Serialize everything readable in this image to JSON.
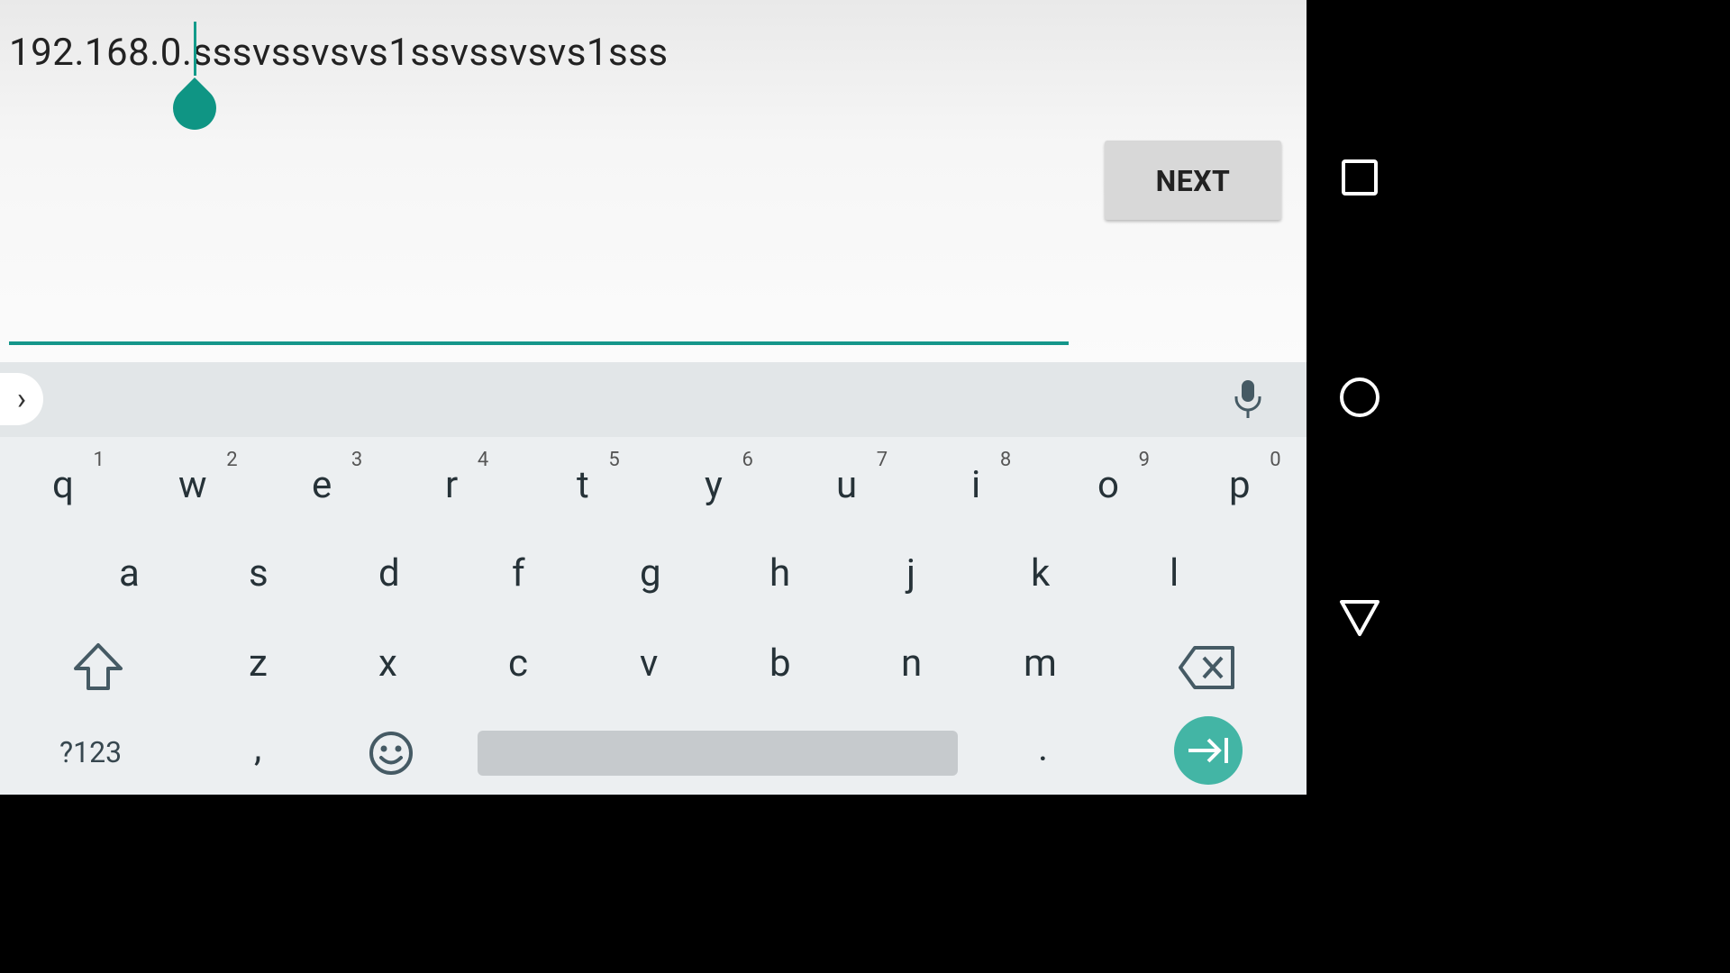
{
  "editor": {
    "text": "192.168.0.sssvssvsvs1ssvssvsvs1sss",
    "next_label": "NEXT"
  },
  "keyboard": {
    "row1": [
      {
        "key": "q",
        "num": "1"
      },
      {
        "key": "w",
        "num": "2"
      },
      {
        "key": "e",
        "num": "3"
      },
      {
        "key": "r",
        "num": "4"
      },
      {
        "key": "t",
        "num": "5"
      },
      {
        "key": "y",
        "num": "6"
      },
      {
        "key": "u",
        "num": "7"
      },
      {
        "key": "i",
        "num": "8"
      },
      {
        "key": "o",
        "num": "9"
      },
      {
        "key": "p",
        "num": "0"
      }
    ],
    "row2": [
      "a",
      "s",
      "d",
      "f",
      "g",
      "h",
      "j",
      "k",
      "l"
    ],
    "row3": [
      "z",
      "x",
      "c",
      "v",
      "b",
      "n",
      "m"
    ],
    "symbols_label": "?123",
    "comma": ",",
    "period": ".",
    "icons": {
      "expand": "chevron-right-icon",
      "mic": "microphone-icon",
      "shift": "shift-icon",
      "backspace": "backspace-icon",
      "emoji": "emoji-icon",
      "enter": "next-field-icon"
    },
    "accent_color": "#43b5a5"
  },
  "nav": {
    "icons": [
      "square-icon",
      "circle-icon",
      "triangle-back-icon"
    ]
  },
  "colors": {
    "accent": "#14968a",
    "key_text": "#263238"
  }
}
